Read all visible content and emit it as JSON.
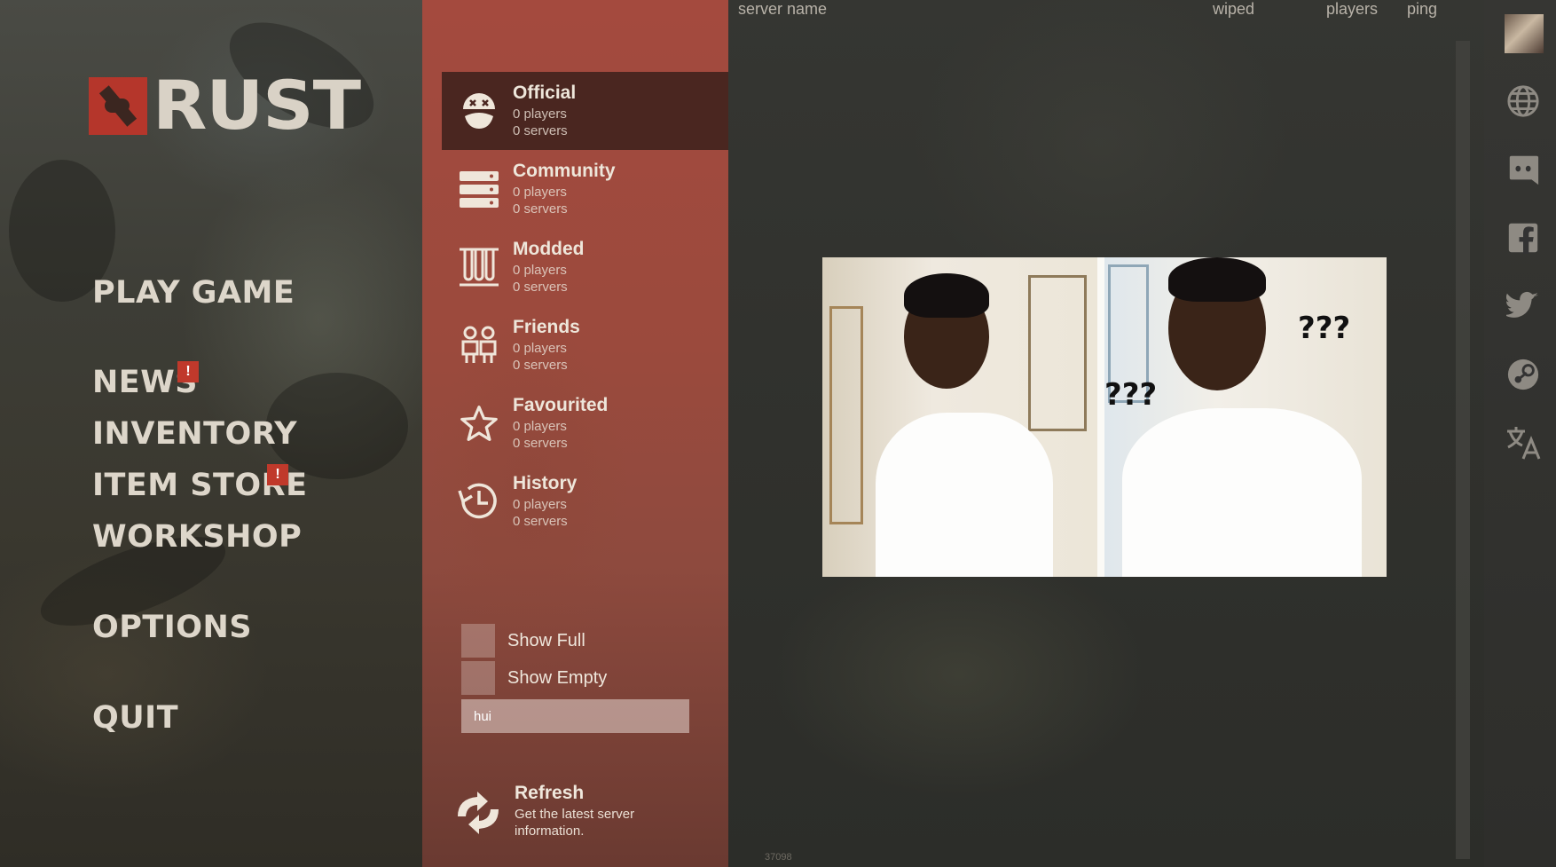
{
  "logo": {
    "text": "RUST"
  },
  "main_menu": {
    "play_game": "PLAY GAME",
    "news": "NEWS",
    "news_badge": "!",
    "inventory": "INVENTORY",
    "item_store": "ITEM STORE",
    "item_store_badge": "!",
    "workshop": "WORKSHOP",
    "options": "OPTIONS",
    "quit": "QUIT"
  },
  "categories": [
    {
      "title": "Official",
      "players": "0 players",
      "servers": "0 servers",
      "icon": "rust-face-icon",
      "selected": true
    },
    {
      "title": "Community",
      "players": "0 players",
      "servers": "0 servers",
      "icon": "server-rack-icon"
    },
    {
      "title": "Modded",
      "players": "0 players",
      "servers": "0 servers",
      "icon": "test-tubes-icon"
    },
    {
      "title": "Friends",
      "players": "0 players",
      "servers": "0 servers",
      "icon": "friends-icon"
    },
    {
      "title": "Favourited",
      "players": "0 players",
      "servers": "0 servers",
      "icon": "star-icon"
    },
    {
      "title": "History",
      "players": "0 players",
      "servers": "0 servers",
      "icon": "history-clock-icon"
    }
  ],
  "filters": {
    "show_full": "Show Full",
    "show_empty": "Show Empty",
    "search_value": "hui"
  },
  "refresh": {
    "title": "Refresh",
    "description": "Get the latest server information."
  },
  "server_list": {
    "columns": {
      "name": "server name",
      "wiped": "wiped",
      "players": "players",
      "ping": "ping"
    },
    "meme_text_left": "???",
    "meme_text_right": "???",
    "version": "37098"
  },
  "social": {
    "icons": [
      "globe-icon",
      "discord-icon",
      "facebook-icon",
      "twitter-icon",
      "steam-icon",
      "translate-icon"
    ]
  },
  "colors": {
    "accent_red": "#b5362b",
    "badge_red": "#c0392b",
    "panel_red": "#9b4a3d",
    "selected_bg": "#4a2620"
  }
}
